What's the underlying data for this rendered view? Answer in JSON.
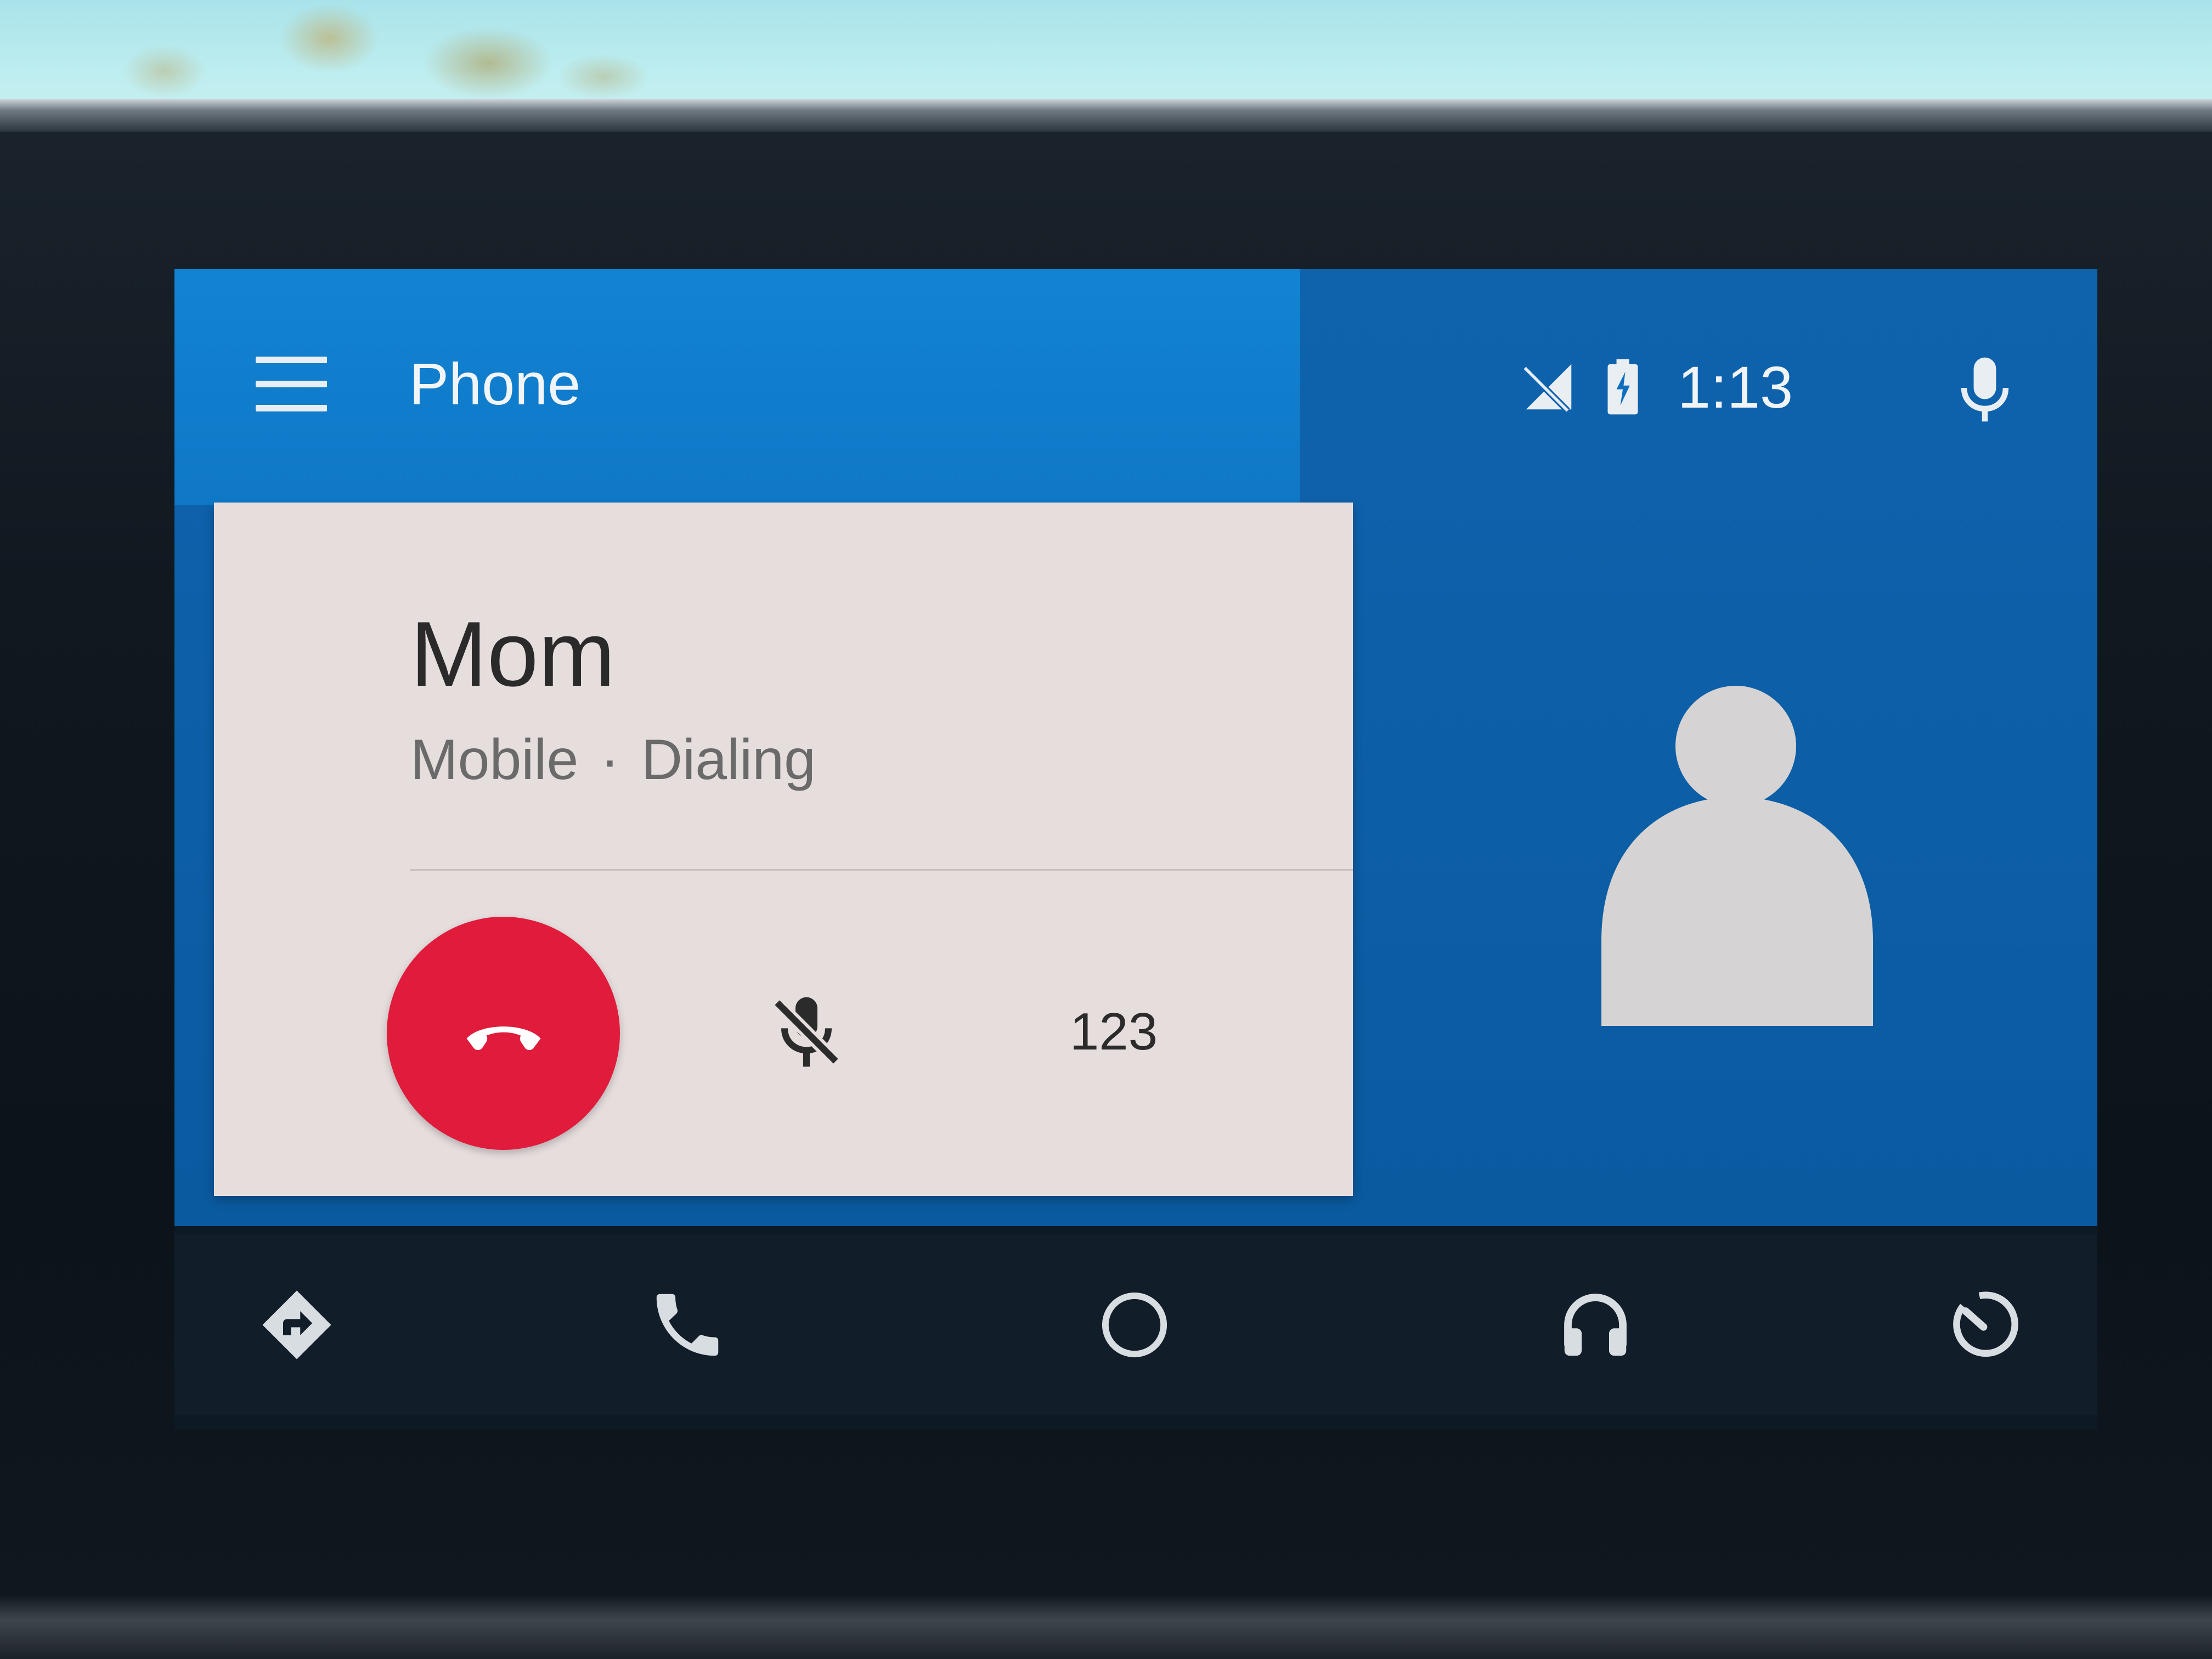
{
  "header": {
    "title": "Phone",
    "time": "1:13",
    "menu_icon": "menu-icon",
    "signal_icon": "no-signal-icon",
    "battery_icon": "battery-charging-icon",
    "voice_icon": "microphone-icon"
  },
  "call": {
    "contact_name": "Mom",
    "number_type": "Mobile",
    "separator": "·",
    "status": "Dialing",
    "end_call_icon": "end-call-icon",
    "mute_icon": "mic-off-icon",
    "keypad_label": "123"
  },
  "avatar_icon": "person-icon",
  "nav": {
    "items": [
      {
        "icon": "navigation-icon"
      },
      {
        "icon": "phone-icon"
      },
      {
        "icon": "home-icon"
      },
      {
        "icon": "headphones-icon"
      },
      {
        "icon": "dashboard-icon"
      }
    ]
  },
  "colors": {
    "header_blue": "#1283d2",
    "background_blue": "#0f63ad",
    "card": "#e6dddd",
    "end_call_red": "#e11b3c",
    "nav_bar": "#111d28",
    "icon_light": "#e9eef3"
  }
}
